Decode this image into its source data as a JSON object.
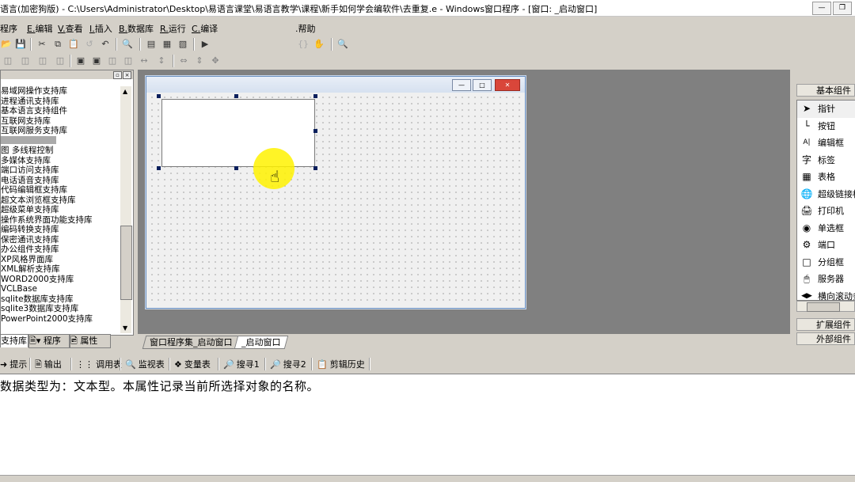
{
  "title": "语言(加密狗版) - C:\\Users\\Administrator\\Desktop\\易语言课堂\\易语言教学\\课程\\新手如何学会编软件\\去重复.e - Windows窗口程序 - [窗口: _启动窗口]",
  "menu": [
    {
      "key": "",
      "label": "程序"
    },
    {
      "key": "E.",
      "label": "编辑"
    },
    {
      "key": "V.",
      "label": "查看"
    },
    {
      "key": "I.",
      "label": "插入"
    },
    {
      "key": "B.",
      "label": "数据库"
    },
    {
      "key": "R.",
      "label": "运行"
    },
    {
      "key": "C.",
      "label": "编译"
    },
    {
      "key": ".",
      "label": "帮助"
    }
  ],
  "libraries": [
    "易域网操作支持库",
    "进程通讯支持库",
    "基本语言支持组件",
    "互联网支持库",
    "互联网服务支持库",
    "",
    "图 多线程控制",
    "多媒体支持库",
    "端口访问支持库",
    "电话语音支持库",
    "代码编辑框支持库",
    "超文本浏览框支持库",
    "超级菜单支持库",
    "操作系统界面功能支持库",
    "编码转换支持库",
    "保密通讯支持库",
    "办公组件支持库",
    "XP风格界面库",
    "XML解析支持库",
    "WORD2000支持库",
    "VCLBase",
    "sqlite数据库支持库",
    "sqlite3数据库支持库",
    "PowerPoint2000支持库"
  ],
  "left_tabs": [
    "支持库",
    "程序",
    "属性"
  ],
  "design_tabs": [
    "窗口程序集_启动窗口",
    "_启动窗口"
  ],
  "right_panel": {
    "basic": "基本组件",
    "components": [
      {
        "icon": "pointer-icon",
        "label": "指针"
      },
      {
        "icon": "button-icon",
        "label": "按钮"
      },
      {
        "icon": "editbox-icon",
        "label": "编辑框"
      },
      {
        "icon": "label-icon",
        "label": "标签"
      },
      {
        "icon": "grid-icon",
        "label": "表格"
      },
      {
        "icon": "hyperlink-icon",
        "label": "超级链接框"
      },
      {
        "icon": "printer-icon",
        "label": "打印机"
      },
      {
        "icon": "radio-icon",
        "label": "单选框"
      },
      {
        "icon": "port-icon",
        "label": "端口"
      },
      {
        "icon": "groupbox-icon",
        "label": "分组框"
      },
      {
        "icon": "server-icon",
        "label": "服务器"
      },
      {
        "icon": "hscrollbar-icon",
        "label": "横向滚动条"
      }
    ],
    "extended": "扩展组件",
    "external": "外部组件"
  },
  "bottom_tabs": [
    {
      "icon": "hint-icon",
      "label": "提示"
    },
    {
      "icon": "output-icon",
      "label": "输出"
    },
    {
      "icon": "callstack-icon",
      "label": "调用表"
    },
    {
      "icon": "watch-icon",
      "label": "监视表"
    },
    {
      "icon": "variable-icon",
      "label": "变量表"
    },
    {
      "icon": "search-icon",
      "label": "搜寻1"
    },
    {
      "icon": "search-icon",
      "label": "搜寻2"
    },
    {
      "icon": "clipboard-icon",
      "label": "剪辑历史"
    }
  ],
  "output_text": "数据类型为：文本型。本属性记录当前所选择对象的名称。"
}
